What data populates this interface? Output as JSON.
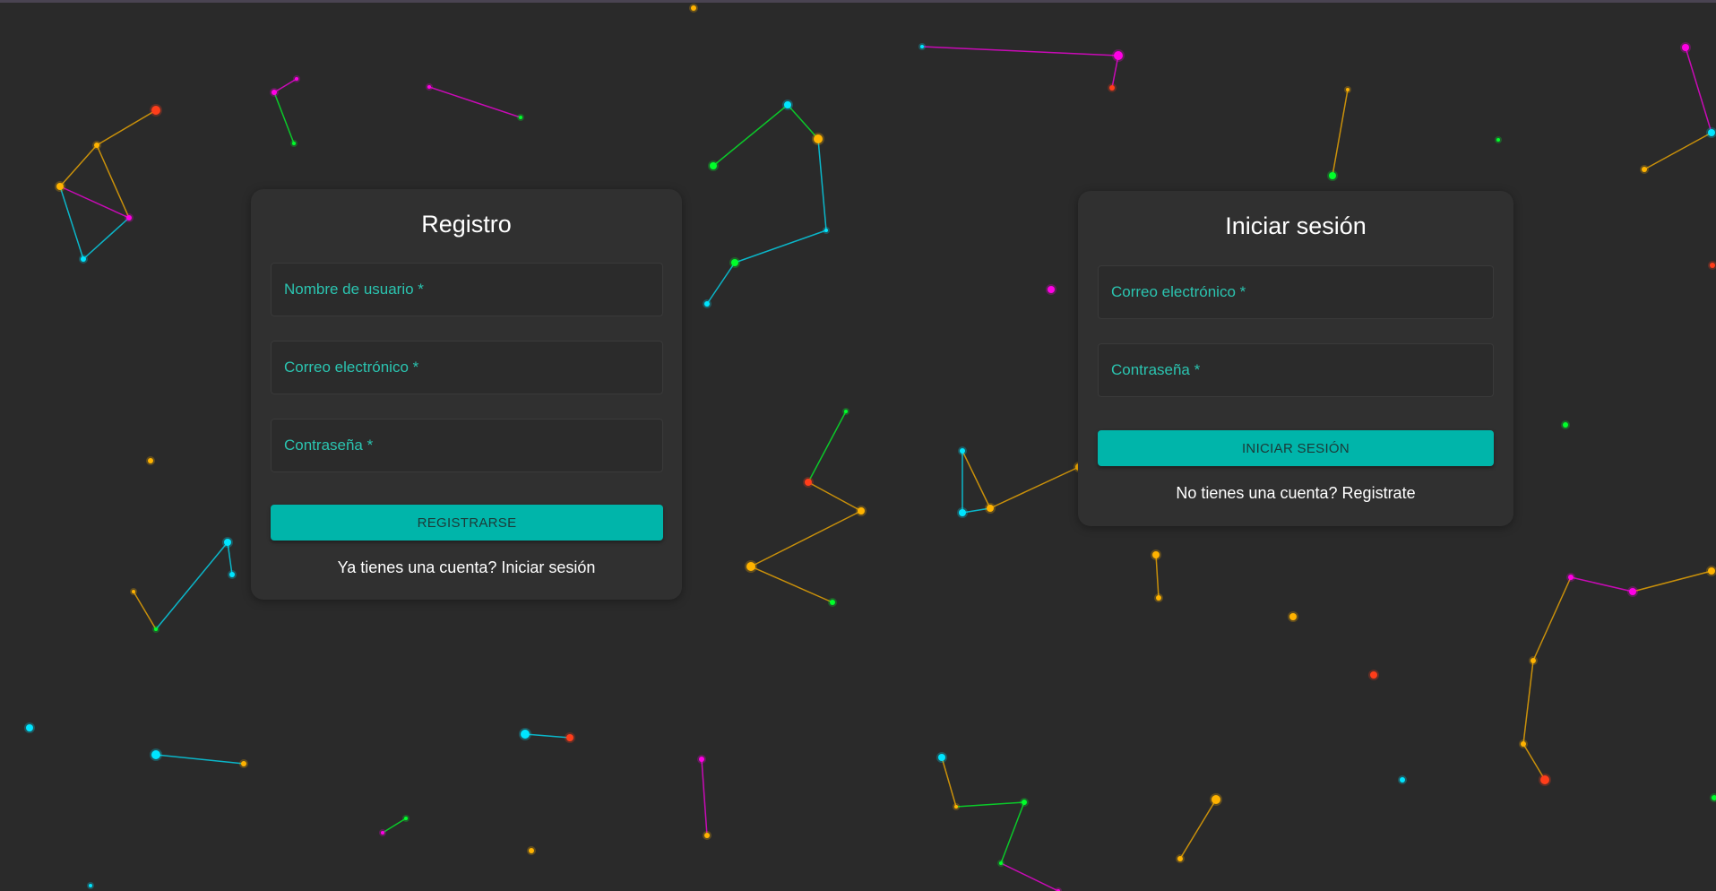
{
  "colors": {
    "background": "#2a2a2a",
    "card": "#303030",
    "accent": "#00b5aa",
    "field_label": "#2bc4b0",
    "particles": [
      "#00e5ff",
      "#ff00e5",
      "#00ff2a",
      "#ffb300",
      "#ff3d1a"
    ]
  },
  "register": {
    "title": "Registro",
    "username_placeholder": "Nombre de usuario *",
    "email_placeholder": "Correo electrónico *",
    "password_placeholder": "Contraseña *",
    "submit_label": "REGISTRARSE",
    "switch_prompt": "Ya tienes una cuenta?",
    "switch_link": "Iniciar sesión"
  },
  "login": {
    "title": "Iniciar sesión",
    "email_placeholder": "Correo electrónico *",
    "password_placeholder": "Contraseña *",
    "submit_label": "INICIAR SESIÓN",
    "switch_prompt": "No tienes una cuenta?",
    "switch_link": "Registrate"
  }
}
